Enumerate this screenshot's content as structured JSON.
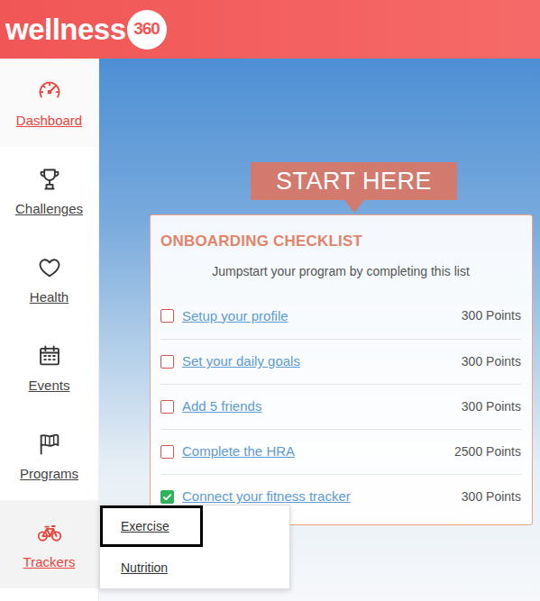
{
  "header": {
    "logo": {
      "text": "wellness",
      "badge": "360"
    }
  },
  "sidebar": {
    "items": [
      {
        "label": "Dashboard",
        "selected": true,
        "expanded": false
      },
      {
        "label": "Challenges",
        "selected": false,
        "expanded": false
      },
      {
        "label": "Health",
        "selected": false,
        "expanded": false
      },
      {
        "label": "Events",
        "selected": false,
        "expanded": false
      },
      {
        "label": "Programs",
        "selected": false,
        "expanded": false
      },
      {
        "label": "Trackers",
        "selected": false,
        "expanded": true
      }
    ]
  },
  "banner": "START HERE",
  "checklist": {
    "title": "ONBOARDING CHECKLIST",
    "subtitle": "Jumpstart your program by completing this list",
    "items": [
      {
        "label": "Setup your profile",
        "points": "300 Points",
        "checked": false
      },
      {
        "label": "Set your daily goals",
        "points": "300 Points",
        "checked": false
      },
      {
        "label": "Add 5 friends",
        "points": "300 Points",
        "checked": false
      },
      {
        "label": "Complete the HRA",
        "points": "2500 Points",
        "checked": false
      },
      {
        "label": "Connect your fitness tracker",
        "points": "300 Points",
        "checked": true
      }
    ]
  },
  "trackers_menu": {
    "items": [
      {
        "label": "Exercise",
        "highlighted": true
      },
      {
        "label": "Nutrition",
        "highlighted": false
      }
    ]
  }
}
